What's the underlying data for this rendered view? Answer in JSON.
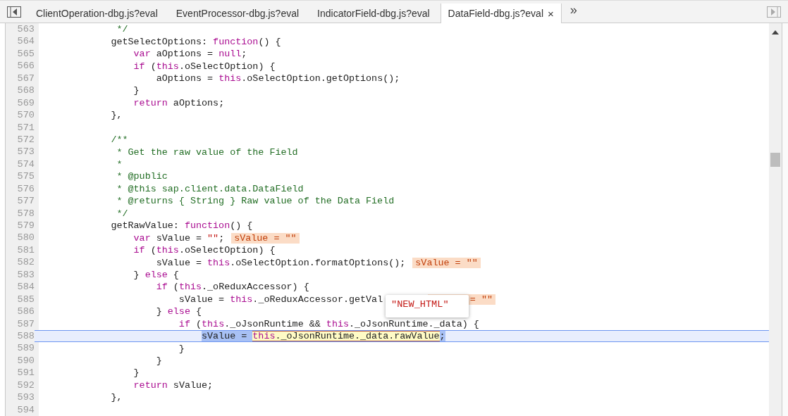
{
  "tabs": [
    {
      "label": "ClientOperation-dbg.js?eval",
      "selected": false
    },
    {
      "label": "EventProcessor-dbg.js?eval",
      "selected": false
    },
    {
      "label": "IndicatorField-dbg.js?eval",
      "selected": false
    },
    {
      "label": "DataField-dbg.js?eval",
      "selected": true
    }
  ],
  "overflow": "»",
  "close": "×",
  "lines": [
    {
      "number": "563",
      "current": false,
      "tokens": [
        {
          "kind": "comment",
          "text": "             */"
        }
      ]
    },
    {
      "number": "564",
      "current": false,
      "tokens": [
        {
          "kind": "plain",
          "text": "            getSelectOptions: "
        },
        {
          "kind": "keyword",
          "text": "function"
        },
        {
          "kind": "plain",
          "text": "() {"
        }
      ]
    },
    {
      "number": "565",
      "current": false,
      "tokens": [
        {
          "kind": "keyword",
          "text": "                var"
        },
        {
          "kind": "plain",
          "text": " aOptions = "
        },
        {
          "kind": "keyword",
          "text": "null"
        },
        {
          "kind": "plain",
          "text": ";"
        }
      ]
    },
    {
      "number": "566",
      "current": false,
      "tokens": [
        {
          "kind": "keyword",
          "text": "                if"
        },
        {
          "kind": "plain",
          "text": " ("
        },
        {
          "kind": "keyword",
          "text": "this"
        },
        {
          "kind": "plain",
          "text": ".oSelectOption) {"
        }
      ]
    },
    {
      "number": "567",
      "current": false,
      "tokens": [
        {
          "kind": "plain",
          "text": "                    aOptions = "
        },
        {
          "kind": "keyword",
          "text": "this"
        },
        {
          "kind": "plain",
          "text": ".oSelectOption.getOptions();"
        }
      ]
    },
    {
      "number": "568",
      "current": false,
      "tokens": [
        {
          "kind": "plain",
          "text": "                }"
        }
      ]
    },
    {
      "number": "569",
      "current": false,
      "tokens": [
        {
          "kind": "keyword",
          "text": "                return"
        },
        {
          "kind": "plain",
          "text": " aOptions;"
        }
      ]
    },
    {
      "number": "570",
      "current": false,
      "tokens": [
        {
          "kind": "plain",
          "text": "            },"
        }
      ]
    },
    {
      "number": "571",
      "current": false
    },
    {
      "number": "572",
      "current": false,
      "tokens": [
        {
          "kind": "comment",
          "text": "            /**"
        }
      ]
    },
    {
      "number": "573",
      "current": false,
      "tokens": [
        {
          "kind": "comment",
          "text": "             * Get the raw value of the Field"
        }
      ]
    },
    {
      "number": "574",
      "current": false,
      "tokens": [
        {
          "kind": "comment",
          "text": "             *"
        }
      ]
    },
    {
      "number": "575",
      "current": false,
      "tokens": [
        {
          "kind": "comment",
          "text": "             * @public"
        }
      ]
    },
    {
      "number": "576",
      "current": false,
      "tokens": [
        {
          "kind": "comment",
          "text": "             * @this sap.client.data.DataField"
        }
      ]
    },
    {
      "number": "577",
      "current": false,
      "tokens": [
        {
          "kind": "comment",
          "text": "             * @returns { String } Raw value of the Data Field"
        }
      ]
    },
    {
      "number": "578",
      "current": false,
      "tokens": [
        {
          "kind": "comment",
          "text": "             */"
        }
      ]
    },
    {
      "number": "579",
      "current": false,
      "tokens": [
        {
          "kind": "plain",
          "text": "            getRawValue: "
        },
        {
          "kind": "keyword",
          "text": "function"
        },
        {
          "kind": "plain",
          "text": "() {"
        }
      ]
    },
    {
      "number": "580",
      "current": false,
      "tokens": [
        {
          "kind": "keyword",
          "text": "                var"
        },
        {
          "kind": "plain",
          "text": " sValue = "
        },
        {
          "kind": "string",
          "text": "\"\""
        },
        {
          "kind": "plain",
          "text": ";"
        }
      ],
      "inline_value": "sValue = \"\""
    },
    {
      "number": "581",
      "current": false,
      "tokens": [
        {
          "kind": "keyword",
          "text": "                if"
        },
        {
          "kind": "plain",
          "text": " ("
        },
        {
          "kind": "keyword",
          "text": "this"
        },
        {
          "kind": "plain",
          "text": ".oSelectOption) {"
        }
      ]
    },
    {
      "number": "582",
      "current": false,
      "tokens": [
        {
          "kind": "plain",
          "text": "                    sValue = "
        },
        {
          "kind": "keyword",
          "text": "this"
        },
        {
          "kind": "plain",
          "text": ".oSelectOption.formatOptions();"
        }
      ],
      "inline_value": "sValue = \"\""
    },
    {
      "number": "583",
      "current": false,
      "tokens": [
        {
          "kind": "plain",
          "text": "                } "
        },
        {
          "kind": "keyword",
          "text": "else"
        },
        {
          "kind": "plain",
          "text": " {"
        }
      ]
    },
    {
      "number": "584",
      "current": false,
      "tokens": [
        {
          "kind": "keyword",
          "text": "                    if"
        },
        {
          "kind": "plain",
          "text": " ("
        },
        {
          "kind": "keyword",
          "text": "this"
        },
        {
          "kind": "plain",
          "text": "._oReduxAccessor) {"
        }
      ]
    },
    {
      "number": "585",
      "current": false,
      "tokens": [
        {
          "kind": "plain",
          "text": "                        sValue = "
        },
        {
          "kind": "keyword",
          "text": "this"
        },
        {
          "kind": "plain",
          "text": "._oReduxAccessor.getVal"
        }
      ],
      "inline_value": "= \"\""
    },
    {
      "number": "586",
      "current": false,
      "tokens": [
        {
          "kind": "plain",
          "text": "                    } "
        },
        {
          "kind": "keyword",
          "text": "else"
        },
        {
          "kind": "plain",
          "text": " {"
        }
      ]
    },
    {
      "number": "587",
      "current": false,
      "tokens": [
        {
          "kind": "keyword",
          "text": "                        if"
        },
        {
          "kind": "plain",
          "text": " ("
        },
        {
          "kind": "keyword",
          "text": "this"
        },
        {
          "kind": "plain",
          "text": "._oJsonRuntime && "
        },
        {
          "kind": "keyword",
          "text": "this"
        },
        {
          "kind": "plain",
          "text": "._oJsonRuntime._data) {"
        }
      ]
    },
    {
      "number": "588",
      "current": true,
      "tokens": [
        {
          "kind": "selection",
          "text": "                            sValue = "
        },
        {
          "kind": "evaluated_keyword",
          "text": "this"
        },
        {
          "kind": "evaluated",
          "text": "._oJsonRuntime._data.rawValue"
        },
        {
          "kind": "selection",
          "text": ";"
        }
      ]
    },
    {
      "number": "589",
      "current": false,
      "tokens": [
        {
          "kind": "plain",
          "text": "                        }"
        }
      ]
    },
    {
      "number": "590",
      "current": false,
      "tokens": [
        {
          "kind": "plain",
          "text": "                    }"
        }
      ]
    },
    {
      "number": "591",
      "current": false,
      "tokens": [
        {
          "kind": "plain",
          "text": "                }"
        }
      ]
    },
    {
      "number": "592",
      "current": false,
      "tokens": [
        {
          "kind": "keyword",
          "text": "                return"
        },
        {
          "kind": "plain",
          "text": " sValue;"
        }
      ]
    },
    {
      "number": "593",
      "current": false,
      "tokens": [
        {
          "kind": "plain",
          "text": "            },"
        }
      ]
    },
    {
      "number": "594",
      "current": false
    }
  ],
  "tooltip": {
    "value": "\"NEW_HTML\""
  }
}
